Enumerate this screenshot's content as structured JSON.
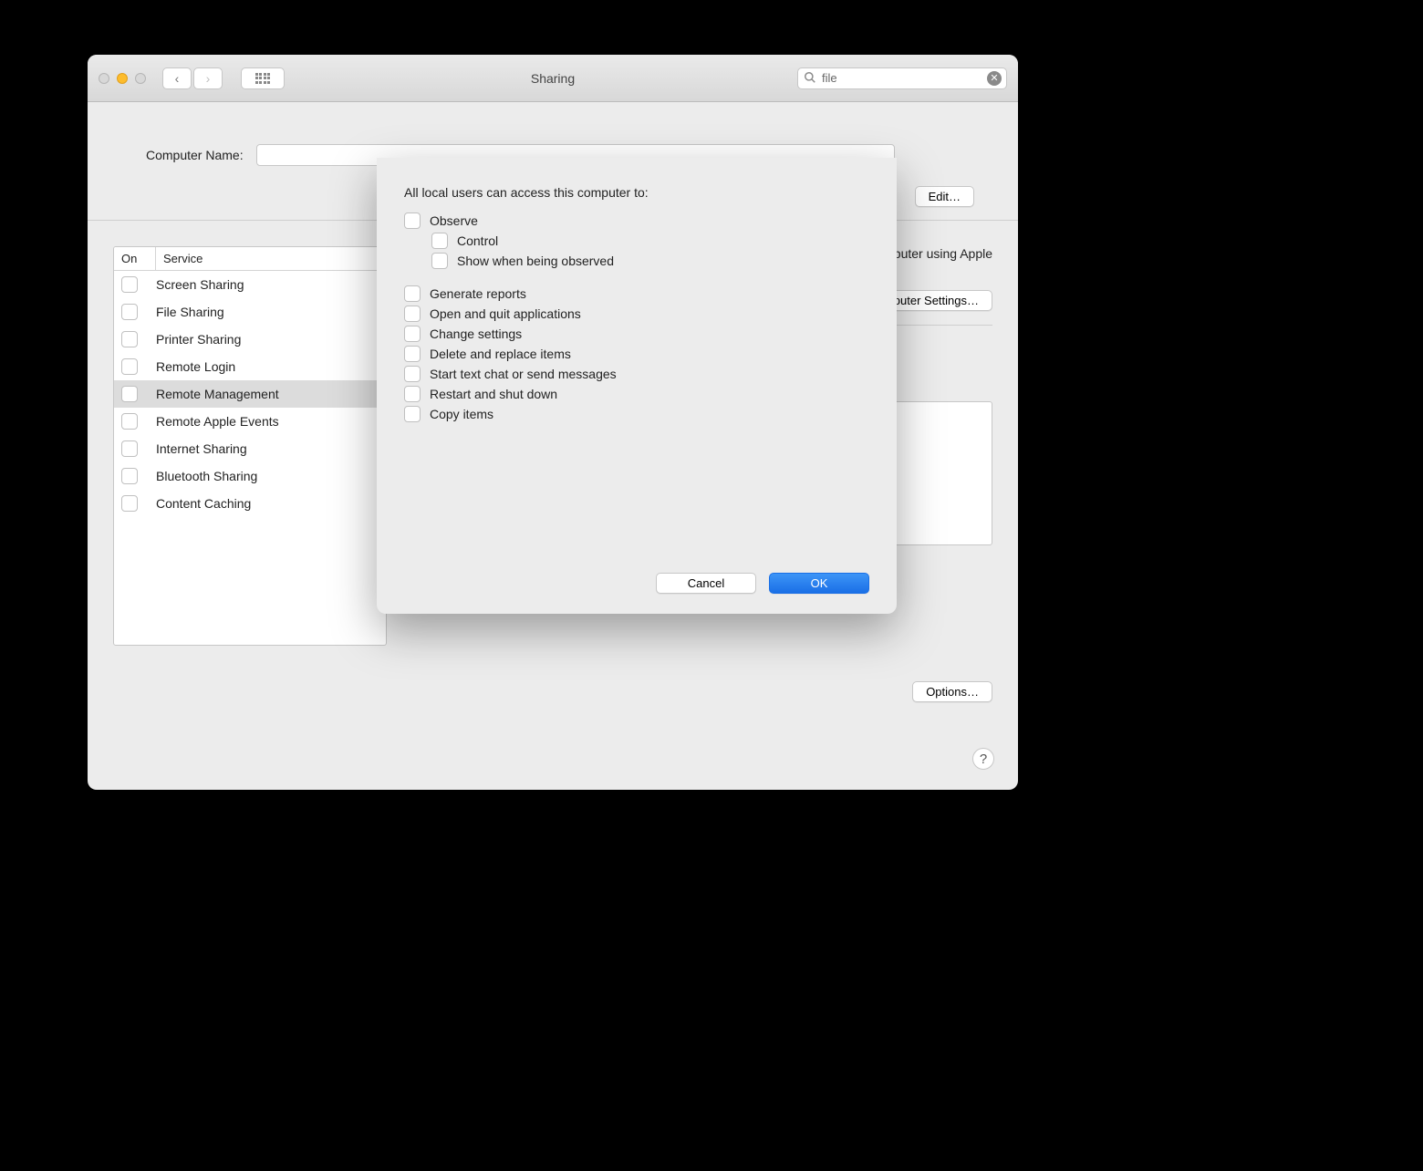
{
  "window": {
    "title": "Sharing",
    "search_value": "file"
  },
  "name_row": {
    "label": "Computer Name:",
    "edit_label": "Edit…"
  },
  "table": {
    "col_on": "On",
    "col_service": "Service",
    "rows": [
      {
        "label": "Screen Sharing",
        "on": false,
        "selected": false
      },
      {
        "label": "File Sharing",
        "on": false,
        "selected": false
      },
      {
        "label": "Printer Sharing",
        "on": false,
        "selected": false
      },
      {
        "label": "Remote Login",
        "on": false,
        "selected": false
      },
      {
        "label": "Remote Management",
        "on": false,
        "selected": true
      },
      {
        "label": "Remote Apple Events",
        "on": false,
        "selected": false
      },
      {
        "label": "Internet Sharing",
        "on": false,
        "selected": false
      },
      {
        "label": "Bluetooth Sharing",
        "on": false,
        "selected": false
      },
      {
        "label": "Content Caching",
        "on": false,
        "selected": false
      }
    ]
  },
  "right": {
    "info_fragment": "s computer using Apple",
    "computer_settings_label": "Computer Settings…",
    "options_label": "Options…"
  },
  "sheet": {
    "title": "All local users can access this computer to:",
    "options": [
      {
        "label": "Observe",
        "indent": 0
      },
      {
        "label": "Control",
        "indent": 1
      },
      {
        "label": "Show when being observed",
        "indent": 1
      },
      {
        "label": "Generate reports",
        "indent": 0,
        "gap_before": true
      },
      {
        "label": "Open and quit applications",
        "indent": 0
      },
      {
        "label": "Change settings",
        "indent": 0
      },
      {
        "label": "Delete and replace items",
        "indent": 0
      },
      {
        "label": "Start text chat or send messages",
        "indent": 0
      },
      {
        "label": "Restart and shut down",
        "indent": 0
      },
      {
        "label": "Copy items",
        "indent": 0
      }
    ],
    "cancel_label": "Cancel",
    "ok_label": "OK"
  }
}
